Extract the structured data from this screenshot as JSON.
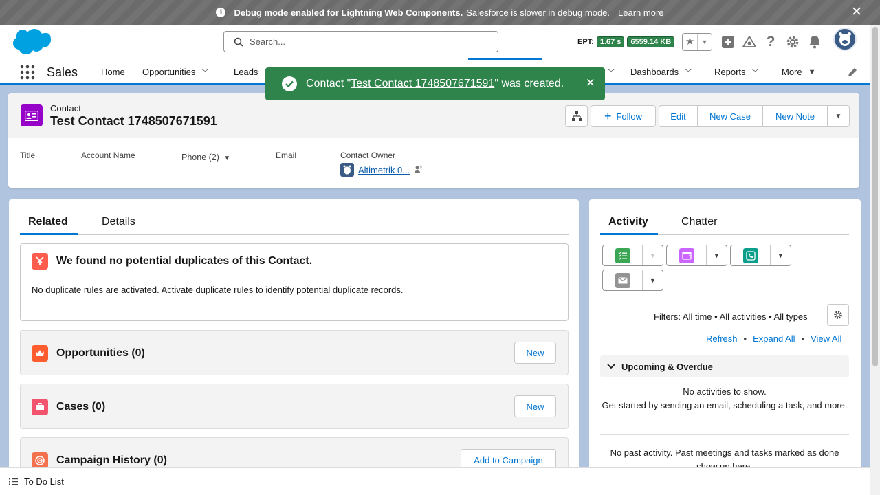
{
  "debug": {
    "bold": "Debug mode enabled for Lightning Web Components.",
    "text": "Salesforce is slower in debug mode.",
    "link": "Learn more",
    "close": "✕"
  },
  "header": {
    "search_placeholder": "Search...",
    "ept_label": "EPT:",
    "ept_time": "1.67 s",
    "ept_size": "6559.14 KB"
  },
  "nav": {
    "app_name": "Sales",
    "items": [
      "Home",
      "Opportunities",
      "Leads",
      "Dashboards",
      "Reports",
      "More"
    ]
  },
  "toast": {
    "prefix": "Contact \"",
    "link": "Test Contact 1748507671591",
    "suffix": "\" was created.",
    "close": "✕"
  },
  "record": {
    "object_label": "Contact",
    "name": "Test Contact 1748507671591",
    "buttons": {
      "follow": "Follow",
      "edit": "Edit",
      "new_case": "New Case",
      "new_note": "New Note"
    },
    "fields": {
      "title": "Title",
      "account_name": "Account Name",
      "phone": "Phone (2)",
      "email": "Email",
      "owner_label": "Contact Owner",
      "owner_value": "Altimetrik 0..."
    }
  },
  "left_panel": {
    "tabs": [
      "Related",
      "Details"
    ],
    "duplicates": {
      "title": "We found no potential duplicates of this Contact.",
      "text": "No duplicate rules are activated. Activate duplicate rules to identify potential duplicate records."
    },
    "cards": [
      {
        "title": "Opportunities (0)",
        "button": "New"
      },
      {
        "title": "Cases (0)",
        "button": "New"
      },
      {
        "title": "Campaign History (0)",
        "button": "Add to Campaign"
      }
    ]
  },
  "right_panel": {
    "tabs": [
      "Activity",
      "Chatter"
    ],
    "filters": "Filters: All time • All activities • All types",
    "links": {
      "refresh": "Refresh",
      "expand_all": "Expand All",
      "view_all": "View All",
      "separator": "•"
    },
    "upcoming": "Upcoming & Overdue",
    "no_activities_1": "No activities to show.",
    "no_activities_2": "Get started by sending an email, scheduling a task, and more.",
    "past": "No past activity. Past meetings and tasks marked as done show up here."
  },
  "footer": {
    "todo": "To Do List"
  },
  "colors": {
    "brand_blue": "#0176d3",
    "toast_green": "#2e844a",
    "contact_icon": "#9602c7"
  }
}
